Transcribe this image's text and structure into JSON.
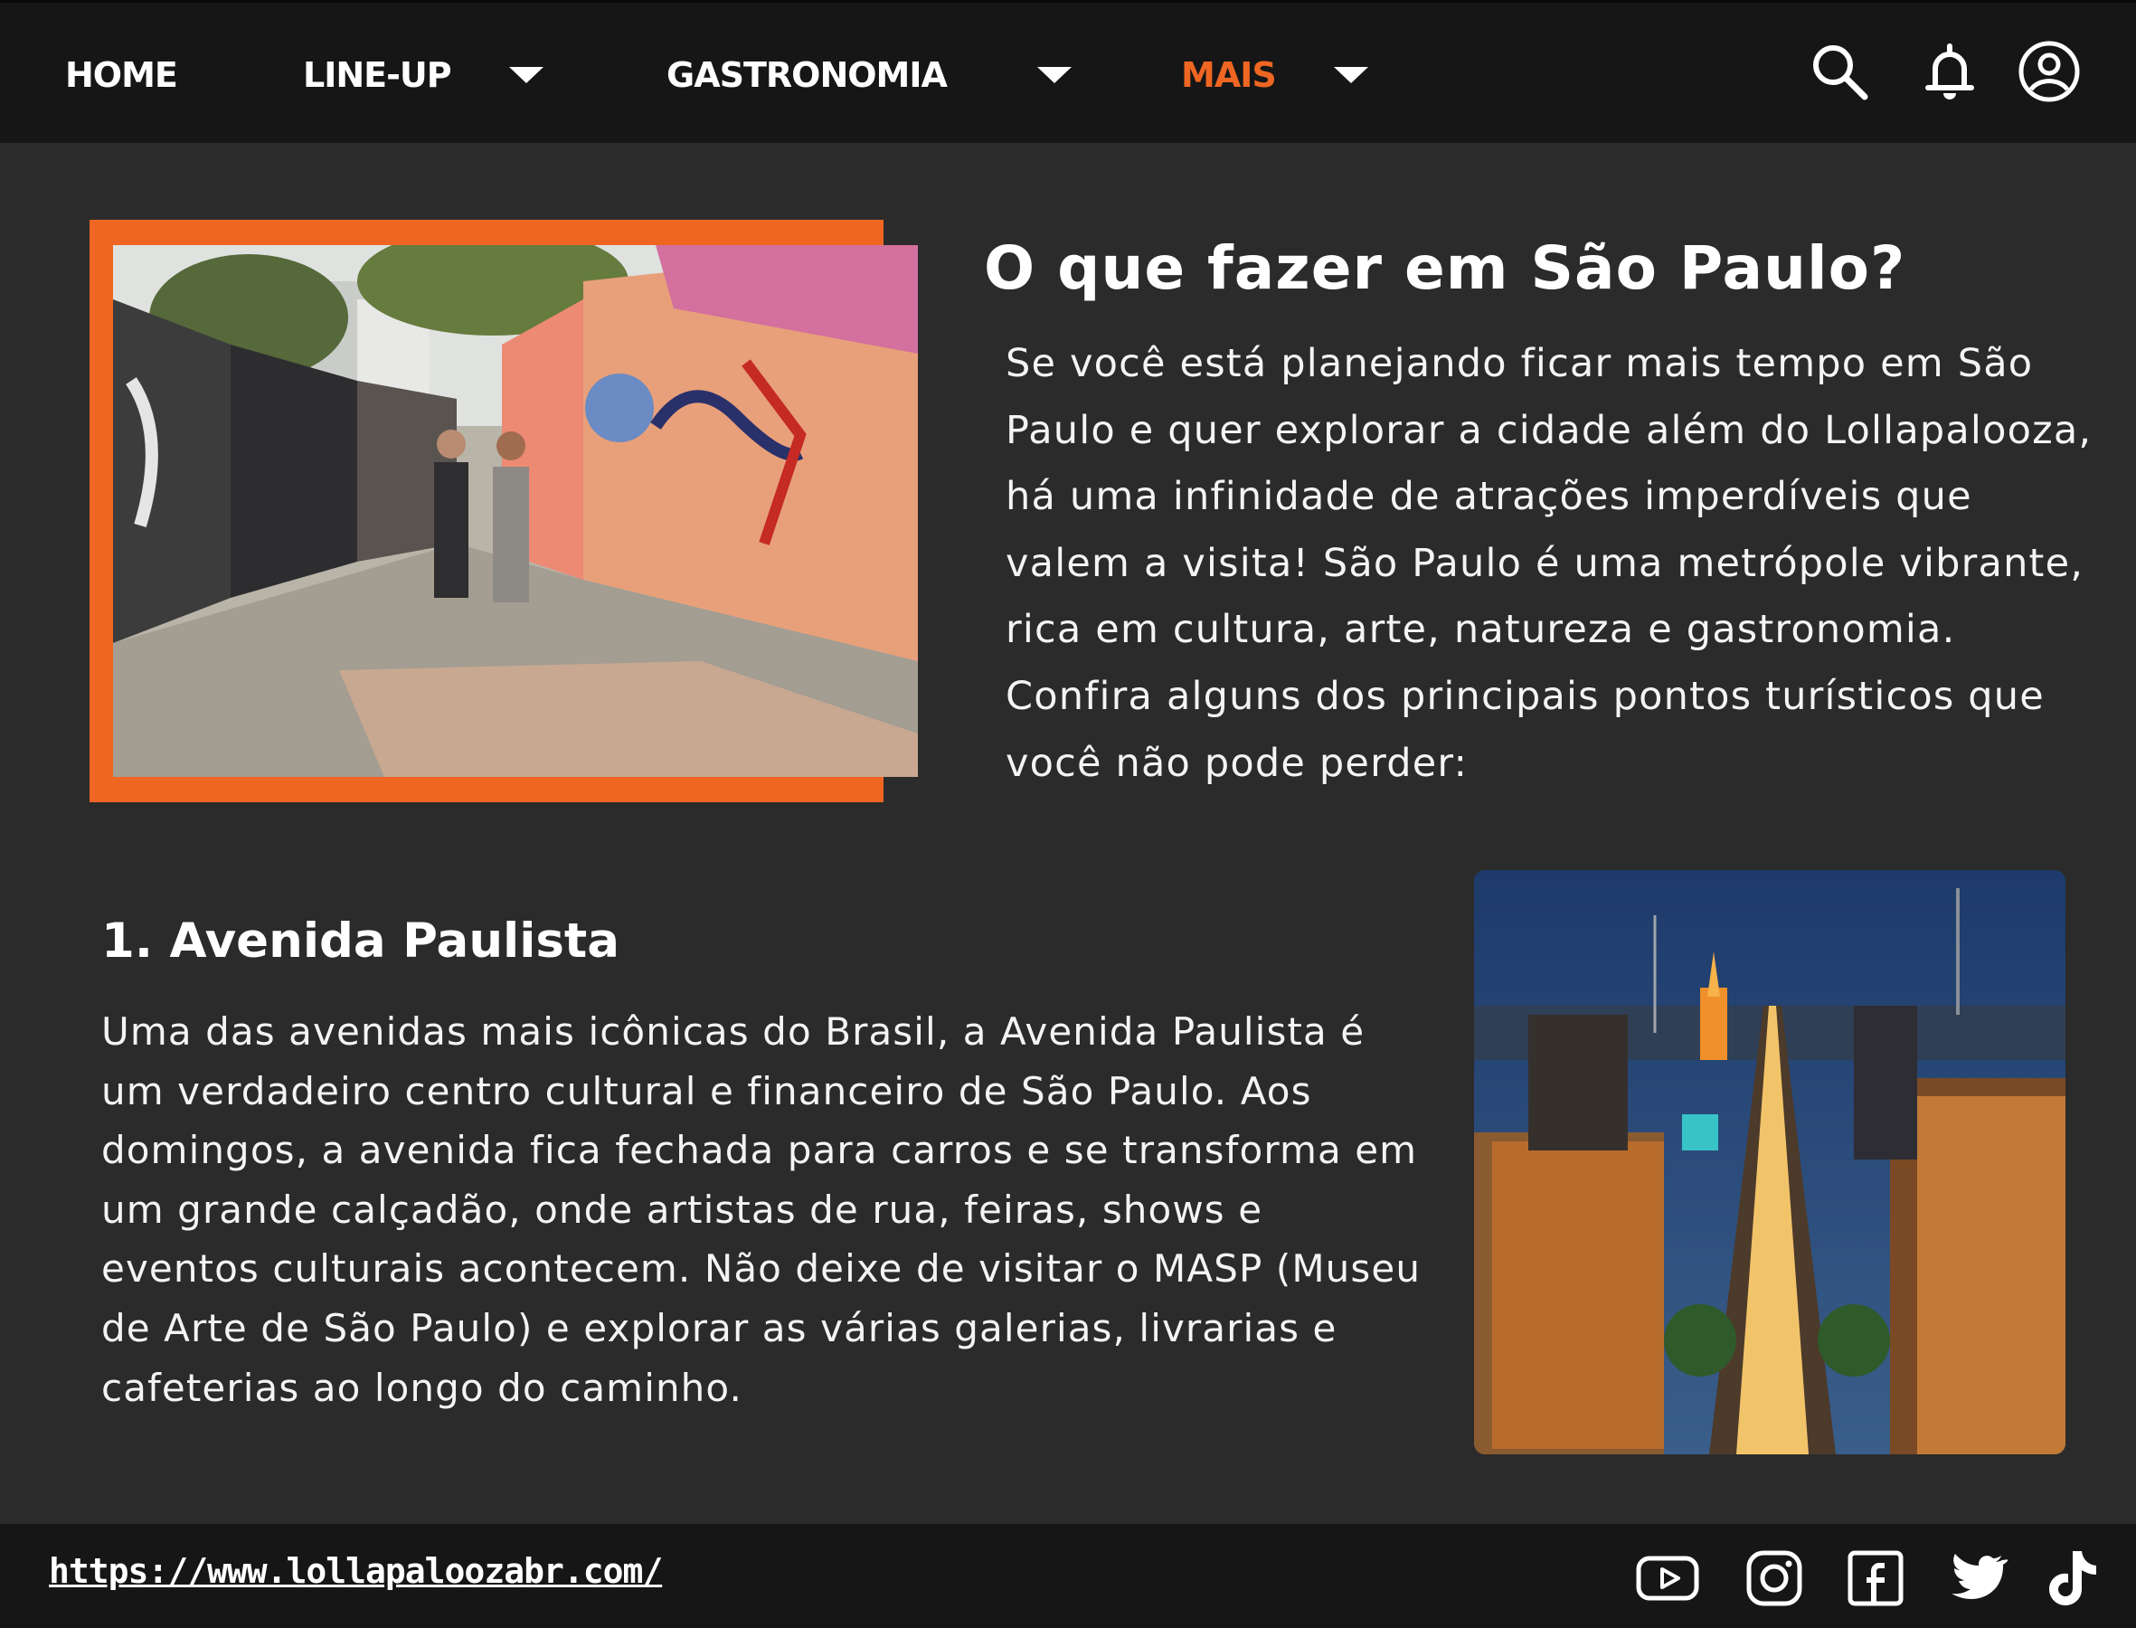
{
  "nav": {
    "items": [
      {
        "label": "HOME"
      },
      {
        "label": "LINE-UP"
      },
      {
        "label": "GASTRONOMIA"
      },
      {
        "label": "MAIS"
      }
    ],
    "active": "MAIS",
    "icons": [
      "search-icon",
      "bell-icon",
      "user-icon"
    ]
  },
  "colors": {
    "accent": "#ef6622",
    "background": "#2b2b2b",
    "bar": "#161616"
  },
  "main": {
    "title": "O que fazer em São Paulo?",
    "intro": "Se você está planejando ficar mais tempo em São Paulo e quer explorar a cidade além do Lollapalooza, há uma infinidade de atrações imperdíveis que valem a visita! São Paulo é uma metrópole vibrante, rica em cultura, arte, natureza e gastronomia. Confira alguns dos principais pontos turísticos que você não pode perder:",
    "section": {
      "title": "1. Avenida Paulista",
      "body": "Uma das avenidas mais icônicas do Brasil, a Avenida Paulista é um verdadeiro centro cultural e financeiro de São Paulo. Aos domingos, a avenida fica fechada para carros e se transforma em um grande calçadão, onde artistas de rua, feiras, shows e eventos culturais acontecem. Não deixe de visitar o MASP (Museu de Arte de São Paulo) e explorar as várias galerias, livrarias e cafeterias ao longo do caminho."
    }
  },
  "footer": {
    "url": "https://www.lollapaloozabr.com/",
    "social_icons": [
      "youtube-icon",
      "instagram-icon",
      "facebook-icon",
      "twitter-icon",
      "tiktok-icon"
    ]
  }
}
